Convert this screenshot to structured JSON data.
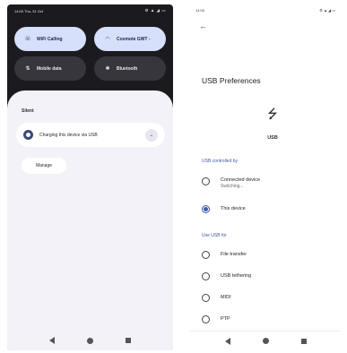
{
  "left": {
    "status": {
      "time": "14:00 Thu, 31 Oct",
      "icons": "⚙ ▲ ◢ ▭"
    },
    "tiles": [
      {
        "label": "WiFi Calling",
        "icon": "☏",
        "state": "on"
      },
      {
        "label": "Cosmote GWT -",
        "icon": "◠",
        "state": "on"
      },
      {
        "label": "Mobile data",
        "icon": "⇅",
        "state": "off"
      },
      {
        "label": "Bluetooth",
        "icon": "✱",
        "state": "off"
      }
    ],
    "section_label": "Silent",
    "notification": {
      "text": "Charging this device via USB"
    },
    "manage_label": "Manage"
  },
  "right": {
    "status": {
      "time": "14:00",
      "icons": "⚙ ▲ ◢ ▭"
    },
    "title": "USB Preferences",
    "usb_label": "USB",
    "controlled_by": {
      "header": "USB controlled by",
      "options": [
        {
          "label": "Connected device",
          "sublabel": "Switching...",
          "selected": false
        },
        {
          "label": "This device",
          "sublabel": "",
          "selected": true
        }
      ]
    },
    "use_for": {
      "header": "Use USB for",
      "options": [
        {
          "label": "File transfer",
          "selected": false
        },
        {
          "label": "USB tethering",
          "selected": false
        },
        {
          "label": "MIDI",
          "selected": false
        },
        {
          "label": "PTP",
          "selected": false
        }
      ]
    }
  },
  "colors": {
    "accent": "#3e5aa5",
    "tile_on": "#d7e0fb",
    "shade_bg": "#1b1b1f"
  }
}
